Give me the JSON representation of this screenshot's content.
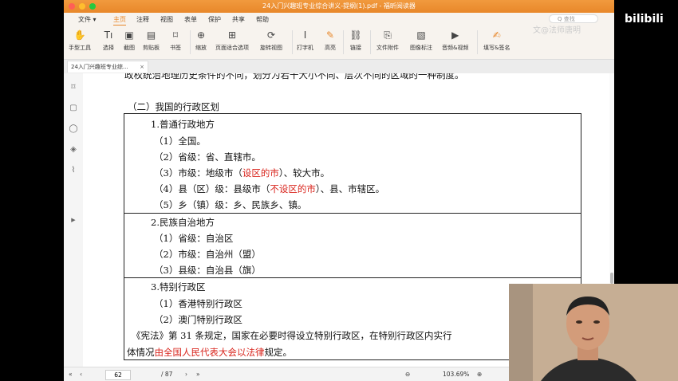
{
  "window": {
    "title": "24入门兴趣班专业综合讲义-提纲(1).pdf - 福昕阅读器"
  },
  "menu": {
    "file": "文件 ▾",
    "items": [
      "主页",
      "注释",
      "视图",
      "表单",
      "保护",
      "共享",
      "帮助"
    ],
    "active": "主页"
  },
  "search": {
    "placeholder": "Q 查找"
  },
  "toolbar": [
    {
      "label": "手型工具",
      "icon": "hand-icon"
    },
    {
      "label": "选择",
      "icon": "text-select-icon"
    },
    {
      "label": "截图",
      "icon": "screenshot-icon"
    },
    {
      "label": "剪贴板",
      "icon": "clipboard-icon"
    },
    {
      "label": "书签",
      "icon": "bookmark-icon"
    },
    {
      "label": "缩放",
      "icon": "zoom-icon"
    },
    {
      "label": "页面适合选项",
      "icon": "fit-page-icon"
    },
    {
      "label": "旋转视图",
      "icon": "rotate-icon"
    },
    {
      "label": "打字机",
      "icon": "typewriter-icon"
    },
    {
      "label": "高亮",
      "icon": "highlight-icon"
    },
    {
      "label": "链接",
      "icon": "link-icon"
    },
    {
      "label": "文件附件",
      "icon": "attachment-icon"
    },
    {
      "label": "图像标注",
      "icon": "image-annotation-icon"
    },
    {
      "label": "音频&视频",
      "icon": "media-icon"
    },
    {
      "label": "填写&签名",
      "icon": "sign-icon"
    }
  ],
  "tab": {
    "label": "24入门兴趣班专业综...",
    "close": "×"
  },
  "doc": {
    "top_cut": "政权统治地理历史条件的不同，划分为若干大小不同、层次不同的区域的一种制度。",
    "section": "（二）我国的行政区划",
    "g1_title": "1.普通行政地方",
    "g1_1": "（1）全国。",
    "g1_2": "（2）省级：省、直辖市。",
    "g1_3a": "（3）市级：地级市（",
    "g1_3r": "设区的市",
    "g1_3b": "）、较大市。",
    "g1_4a": "（4）县（区）级：县级市（",
    "g1_4r": "不设区的市",
    "g1_4b": "）、县、市辖区。",
    "g1_5": "（5）乡（镇）级：乡、民族乡、镇。",
    "g2_title": "2.民族自治地方",
    "g2_1": "（1）省级：自治区",
    "g2_2": "（2）市级：自治州（盟）",
    "g2_3": "（3）县级：自治县（旗）",
    "g3_title": "3.特别行政区",
    "g3_1": "（1）香港特别行政区",
    "g3_2": "（2）澳门特别行政区",
    "para1": "《宪法》第 31 条规定，国家在必要时得设立特别行政区，在特别行政区内实行",
    "para2a": "体情况",
    "para2r": "由全国人民代表大会以法律",
    "para2b": "规定。"
  },
  "status": {
    "page": "62",
    "total": "/ 87",
    "zoom": "103.69%"
  },
  "overlay": {
    "logo": "bilibili",
    "watermark": "文@法师唐明"
  }
}
